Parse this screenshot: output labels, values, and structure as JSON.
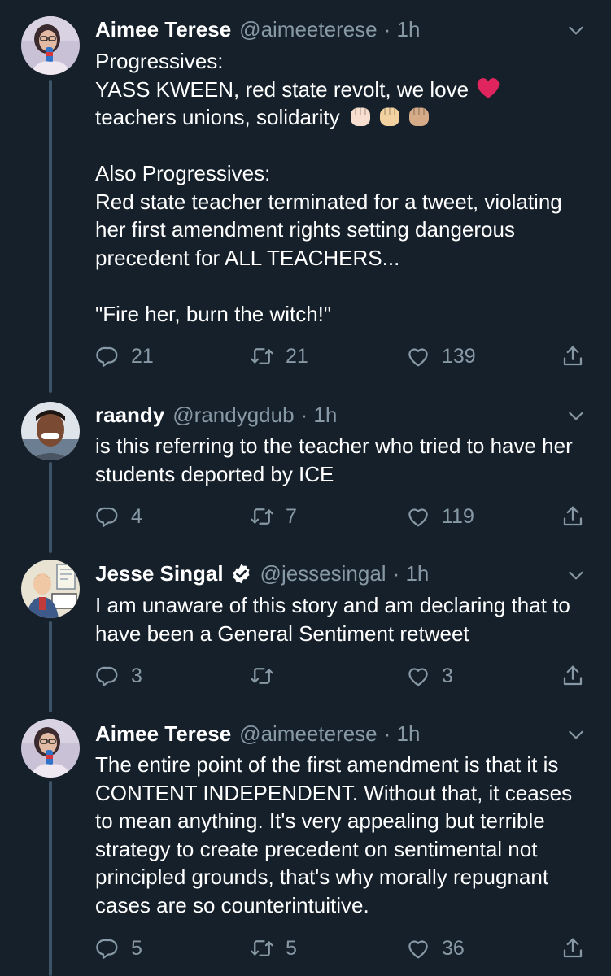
{
  "tweets": [
    {
      "name": "Aimee Terese",
      "handle": "@aimeeterese",
      "time": "· 1h",
      "text_1": "Progressives:\nYASS KWEEN, red state revolt, we love ",
      "emoji_heart": "red-heart",
      "text_2": "\nteachers unions, solidarity ",
      "emoji_fists": [
        "raised-fist-light",
        "raised-fist-medium-light",
        "raised-fist-medium"
      ],
      "text_3": "\n\nAlso Progressives:\nRed state teacher terminated for a tweet, violating her first amendment rights setting dangerous precedent for ALL TEACHERS...\n\n\"Fire her, burn the witch!\"",
      "replies": "21",
      "retweets": "21",
      "likes": "139"
    },
    {
      "name": "raandy",
      "handle": "@randygdub",
      "time": "· 1h",
      "text": "is this referring to the teacher who tried to have her students deported by ICE",
      "replies": "4",
      "retweets": "7",
      "likes": "119"
    },
    {
      "name": "Jesse Singal",
      "handle": "@jessesingal",
      "time": "· 1h",
      "verified": true,
      "text": "I am unaware of this story and am declaring that to have been a General Sentiment retweet",
      "replies": "3",
      "retweets": "",
      "likes": "3"
    },
    {
      "name": "Aimee Terese",
      "handle": "@aimeeterese",
      "time": "· 1h",
      "text": "The entire point of the first amendment is that it is CONTENT INDEPENDENT. Without that, it ceases to mean anything. It's very appealing but terrible strategy to create precedent on sentimental not principled grounds, that's why morally repugnant cases are so counterintuitive.",
      "replies": "5",
      "retweets": "5",
      "likes": "36"
    }
  ],
  "colors": {
    "background": "#15202b",
    "secondary_text": "#8899a6",
    "thread_line": "#3d5466",
    "verified_badge": "#ffffff",
    "heart": "#e0245e"
  }
}
